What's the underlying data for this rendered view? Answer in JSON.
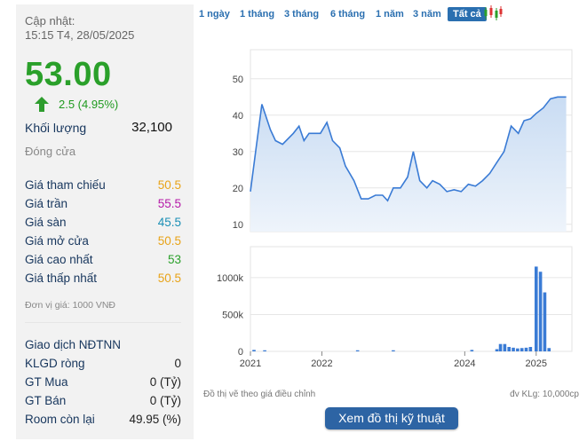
{
  "stock": {
    "updated_label": "Cập nhật:",
    "updated_time": "15:15 T4, 28/05/2025",
    "price": "53.00",
    "change": "2.5 (4.95%)",
    "volume_label": "Khối lượng",
    "volume": "32,100",
    "status": "Đóng cửa",
    "unit_note": "Đơn vị giá: 1000 VNĐ"
  },
  "colors": {
    "up": "#2aa02a",
    "ref": "#e8a317",
    "ceil": "#b51aa8",
    "floor": "#1a8fb5",
    "accent": "#2a6fb0",
    "button": "#2d64a4"
  },
  "price_rows": [
    {
      "label": "Giá tham chiếu",
      "value": "50.5",
      "color": "#e8a317"
    },
    {
      "label": "Giá trần",
      "value": "55.5",
      "color": "#b51aa8"
    },
    {
      "label": "Giá sàn",
      "value": "45.5",
      "color": "#1a8fb5"
    },
    {
      "label": "Giá mở cửa",
      "value": "50.5",
      "color": "#e8a317"
    },
    {
      "label": "Giá cao nhất",
      "value": "53",
      "color": "#2aa02a"
    },
    {
      "label": "Giá thấp nhất",
      "value": "50.5",
      "color": "#e8a317"
    }
  ],
  "foreign_rows": [
    {
      "label": "Giao dịch NĐTNN",
      "value": ""
    },
    {
      "label": "KLGD ròng",
      "value": "0"
    },
    {
      "label": "GT Mua",
      "value": "0 (Tỷ)"
    },
    {
      "label": "GT Bán",
      "value": "0 (Tỷ)"
    },
    {
      "label": "Room còn lại",
      "value": "49.95 (%)"
    }
  ],
  "tabs": [
    {
      "label": "1 ngày"
    },
    {
      "label": "1 tháng"
    },
    {
      "label": "3 tháng"
    },
    {
      "label": "6 tháng"
    },
    {
      "label": "1 năm"
    },
    {
      "label": "3 năm"
    },
    {
      "label": "Tất cả",
      "active": true
    }
  ],
  "candle_icon": "candlestick-icon",
  "chart_data": [
    {
      "type": "line",
      "yticks": [
        10,
        20,
        30,
        40,
        50
      ],
      "ylim": [
        8,
        58
      ],
      "xlim": [
        2021.0,
        2025.5
      ],
      "x": [
        2021.0,
        2021.08,
        2021.16,
        2021.28,
        2021.35,
        2021.45,
        2021.6,
        2021.68,
        2021.75,
        2021.82,
        2021.9,
        2021.98,
        2022.07,
        2022.15,
        2022.25,
        2022.33,
        2022.45,
        2022.55,
        2022.65,
        2022.75,
        2022.85,
        2022.92,
        2023.0,
        2023.1,
        2023.2,
        2023.28,
        2023.37,
        2023.47,
        2023.55,
        2023.65,
        2023.75,
        2023.85,
        2023.95,
        2024.05,
        2024.15,
        2024.25,
        2024.35,
        2024.45,
        2024.55,
        2024.65,
        2024.75,
        2024.83,
        2024.92,
        2025.0,
        2025.1,
        2025.2,
        2025.3,
        2025.42
      ],
      "y": [
        19,
        31,
        43,
        36,
        33,
        32,
        35,
        37,
        33,
        35,
        35,
        35,
        38,
        33,
        31,
        26,
        22,
        17,
        17,
        18,
        18,
        16.5,
        20,
        20,
        23,
        30,
        22,
        20,
        22,
        21,
        19,
        19.5,
        19,
        21,
        20.5,
        22,
        24,
        27,
        30,
        37,
        35,
        38.5,
        39,
        40.5,
        42,
        44.5,
        45,
        45
      ]
    },
    {
      "type": "bar",
      "ylabel_ticks": [
        "0",
        "500k",
        "1000k"
      ],
      "yticks": [
        0,
        500000,
        1000000
      ],
      "ylim": [
        0,
        1420000
      ],
      "xticks": [
        "2021",
        "2022",
        "2024",
        "2025"
      ],
      "xtick_values": [
        2021.0,
        2022.0,
        2024.0,
        2025.0
      ],
      "x": [
        2021.05,
        2021.2,
        2022.5,
        2023.0,
        2024.1,
        2024.45,
        2024.5,
        2024.56,
        2024.62,
        2024.68,
        2024.74,
        2024.8,
        2024.86,
        2024.92,
        2025.0,
        2025.06,
        2025.12,
        2025.18
      ],
      "values": [
        20000,
        15000,
        15000,
        15000,
        20000,
        30000,
        100000,
        100000,
        60000,
        50000,
        40000,
        45000,
        50000,
        60000,
        1150000,
        1080000,
        800000,
        45000
      ]
    }
  ],
  "chart_footer": {
    "left_note": "Đồ thị vẽ theo giá điều chỉnh",
    "right_note": "đv KLg: 10,000cp"
  },
  "button": {
    "label": "Xem đồ thị kỹ thuật"
  }
}
